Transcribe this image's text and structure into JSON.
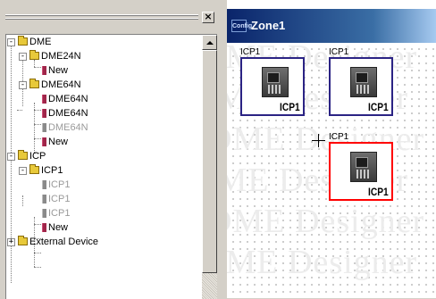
{
  "tree": {
    "close_glyph": "×",
    "items": [
      {
        "label": "DME",
        "icon": "folder-icon",
        "expander": "-",
        "dim": false
      },
      {
        "label": "DME24N",
        "icon": "folder-icon",
        "expander": "-",
        "dim": false
      },
      {
        "label": "New",
        "icon": "device-icon",
        "dim": false
      },
      {
        "label": "DME64N",
        "icon": "folder-icon",
        "expander": "-",
        "dim": false
      },
      {
        "label": "DME64N",
        "icon": "device-icon",
        "dim": false
      },
      {
        "label": "DME64N",
        "icon": "device-icon",
        "dim": false
      },
      {
        "label": "DME64N",
        "icon": "device-icon",
        "dim": true
      },
      {
        "label": "New",
        "icon": "device-icon",
        "dim": false
      },
      {
        "label": "ICP",
        "icon": "folder-icon",
        "expander": "-",
        "dim": false
      },
      {
        "label": "ICP1",
        "icon": "folder-icon",
        "expander": "-",
        "dim": false
      },
      {
        "label": "ICP1",
        "icon": "device-icon",
        "dim": true
      },
      {
        "label": "ICP1",
        "icon": "device-icon",
        "dim": true
      },
      {
        "label": "ICP1",
        "icon": "device-icon",
        "dim": true
      },
      {
        "label": "New",
        "icon": "device-icon",
        "dim": false
      },
      {
        "label": "External Device",
        "icon": "folder-icon",
        "expander": "+",
        "dim": false
      }
    ]
  },
  "zone": {
    "icon_text": "Config",
    "title": "Zone1",
    "watermark_text": "DME Designer",
    "nodes": [
      {
        "name": "ICP1",
        "label": "ICP1",
        "selected": false
      },
      {
        "name": "ICP1",
        "label": "ICP1",
        "selected": false
      },
      {
        "name": "ICP1",
        "label": "ICP1",
        "selected": true
      }
    ]
  },
  "colors": {
    "titlebar_start": "#0a246a",
    "node_border": "#2b2384",
    "selected_border": "#ff0000",
    "device_icon": "#a0264a"
  }
}
